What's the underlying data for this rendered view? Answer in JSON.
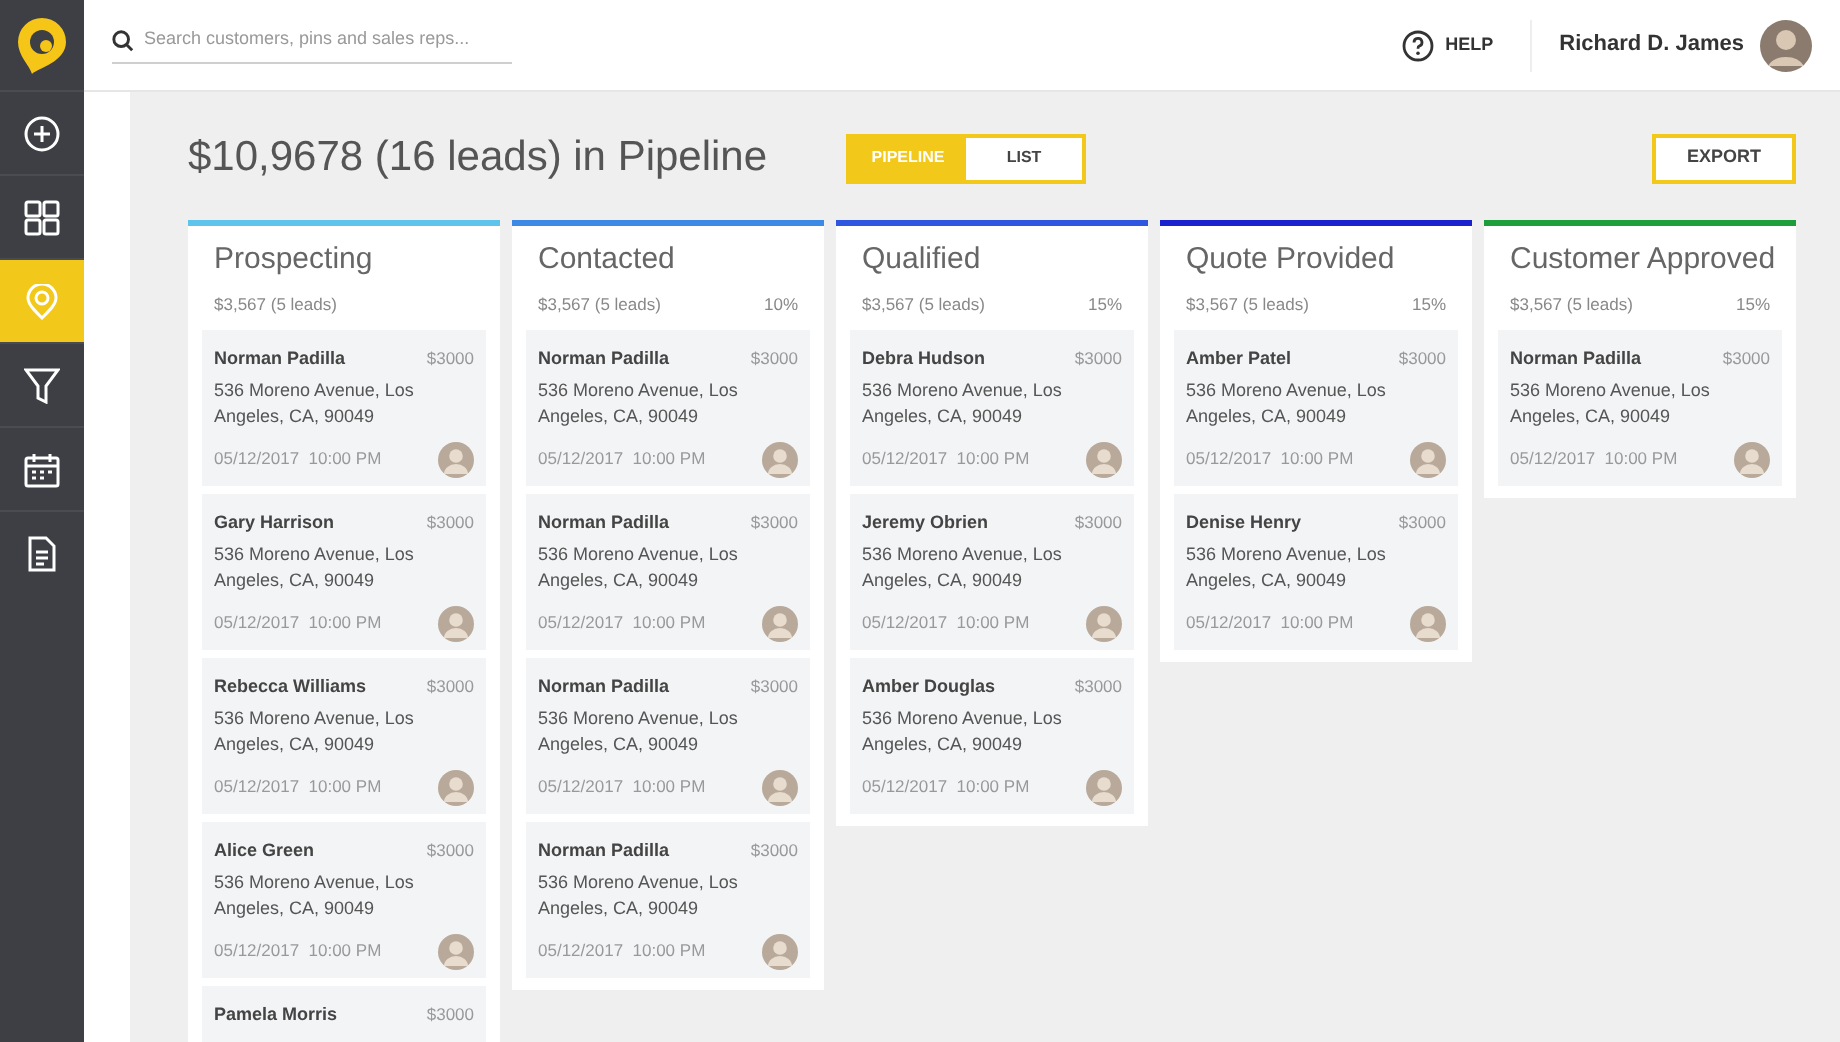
{
  "sidebar": {
    "items": [
      {
        "selected": false
      },
      {
        "selected": false
      },
      {
        "selected": true
      },
      {
        "selected": false
      },
      {
        "selected": false
      },
      {
        "selected": false
      }
    ]
  },
  "header": {
    "search": {
      "placeholder": "Search customers, pins and sales reps..."
    },
    "help": "HELP",
    "user": "Richard D. James"
  },
  "title": "$10,9678 (16 leads) in Pipeline",
  "view_toggle": [
    {
      "label": "PIPELINE",
      "selected": true
    },
    {
      "label": "LIST",
      "selected": false
    }
  ],
  "export": "EXPORT",
  "columns": [
    {
      "title": "Prospecting",
      "summary": "$3,567 (5 leads)",
      "color": "#5ec4ec",
      "cards": [
        {
          "name": "Norman Padilla",
          "amount": "$3000",
          "address": "536 Moreno Avenue, Los Angeles, CA, 90049",
          "date": "05/12/2017  10:00 PM"
        },
        {
          "name": "Gary Harrison",
          "amount": "$3000",
          "address": "536 Moreno Avenue, Los Angeles, CA, 90049",
          "date": "05/12/2017  10:00 PM"
        },
        {
          "name": "Rebecca Williams",
          "amount": "$3000",
          "address": "536 Moreno Avenue, Los Angeles, CA, 90049",
          "date": "05/12/2017  10:00 PM"
        },
        {
          "name": "Alice Green",
          "amount": "$3000",
          "address": "536 Moreno Avenue, Los Angeles, CA, 90049",
          "date": "05/12/2017  10:00 PM"
        },
        {
          "name": "Pamela Morris",
          "amount": "$3000"
        }
      ]
    },
    {
      "title": "Contacted",
      "summary": "$3,567 (5 leads)",
      "percent": "10%",
      "color": "#3b8ae6",
      "cards": [
        {
          "name": "Norman Padilla",
          "amount": "$3000",
          "address": "536 Moreno Avenue, Los Angeles, CA, 90049",
          "date": "05/12/2017  10:00 PM"
        },
        {
          "name": "Norman Padilla",
          "amount": "$3000",
          "address": "536 Moreno Avenue, Los Angeles, CA, 90049",
          "date": "05/12/2017  10:00 PM"
        },
        {
          "name": "Norman Padilla",
          "amount": "$3000",
          "address": "536 Moreno Avenue, Los Angeles, CA, 90049",
          "date": "05/12/2017  10:00 PM"
        },
        {
          "name": "Norman Padilla",
          "amount": "$3000",
          "address": "536 Moreno Avenue, Los Angeles, CA, 90049",
          "date": "05/12/2017  10:00 PM"
        }
      ]
    },
    {
      "title": "Qualified",
      "summary": "$3,567 (5 leads)",
      "percent": "15%",
      "color": "#2f56e0",
      "cards": [
        {
          "name": "Debra Hudson",
          "amount": "$3000",
          "address": "536 Moreno Avenue, Los Angeles, CA, 90049",
          "date": "05/12/2017  10:00 PM"
        },
        {
          "name": "Jeremy Obrien",
          "amount": "$3000",
          "address": "536 Moreno Avenue, Los Angeles, CA, 90049",
          "date": "05/12/2017  10:00 PM"
        },
        {
          "name": "Amber Douglas",
          "amount": "$3000",
          "address": "536 Moreno Avenue, Los Angeles, CA, 90049",
          "date": "05/12/2017  10:00 PM"
        }
      ]
    },
    {
      "title": "Quote Provided",
      "summary": "$3,567 (5 leads)",
      "percent": "15%",
      "color": "#1a22d0",
      "cards": [
        {
          "name": "Amber Patel",
          "amount": "$3000",
          "address": "536 Moreno Avenue, Los Angeles, CA, 90049",
          "date": "05/12/2017  10:00 PM"
        },
        {
          "name": "Denise Henry",
          "amount": "$3000",
          "address": "536 Moreno Avenue, Los Angeles, CA, 90049",
          "date": "05/12/2017  10:00 PM"
        }
      ]
    },
    {
      "title": "Customer Approved",
      "summary": "$3,567 (5 leads)",
      "percent": "15%",
      "color": "#1e9e3a",
      "cards": [
        {
          "name": "Norman Padilla",
          "amount": "$3000",
          "address": "536 Moreno Avenue, Los Angeles, CA, 90049",
          "date": "05/12/2017  10:00 PM"
        }
      ]
    }
  ]
}
